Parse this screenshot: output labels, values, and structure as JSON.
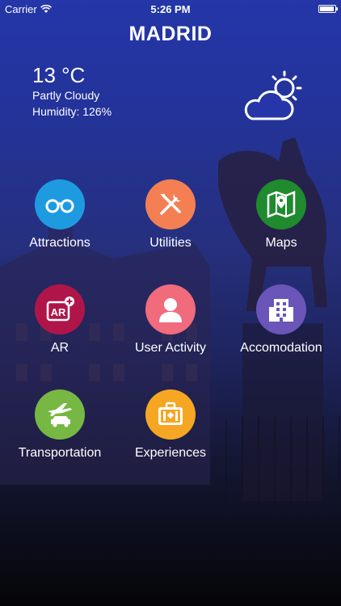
{
  "status_bar": {
    "carrier": "Carrier",
    "time": "5:26 PM",
    "battery_level": 0.95
  },
  "header": {
    "title": "MADRID"
  },
  "weather": {
    "temperature": "13 °C",
    "condition": "Partly Cloudy",
    "humidity": "Humidity: 126%",
    "icon": "partly-cloudy-icon"
  },
  "menu": [
    {
      "label": "Attractions",
      "icon": "binoculars-icon",
      "color": "#1e9be0"
    },
    {
      "label": "Utilities",
      "icon": "tools-icon",
      "color": "#f47f52"
    },
    {
      "label": "Maps",
      "icon": "map-icon",
      "color": "#1f8a2e"
    },
    {
      "label": "AR",
      "icon": "ar-icon",
      "color": "#b0154a"
    },
    {
      "label": "User Activity",
      "icon": "user-icon",
      "color": "#f06b7c"
    },
    {
      "label": "Accomodation",
      "icon": "building-icon",
      "color": "#6a55b8"
    },
    {
      "label": "Transportation",
      "icon": "plane-car-icon",
      "color": "#76b843"
    },
    {
      "label": "Experiences",
      "icon": "suitcase-icon",
      "color": "#f5a623"
    }
  ]
}
